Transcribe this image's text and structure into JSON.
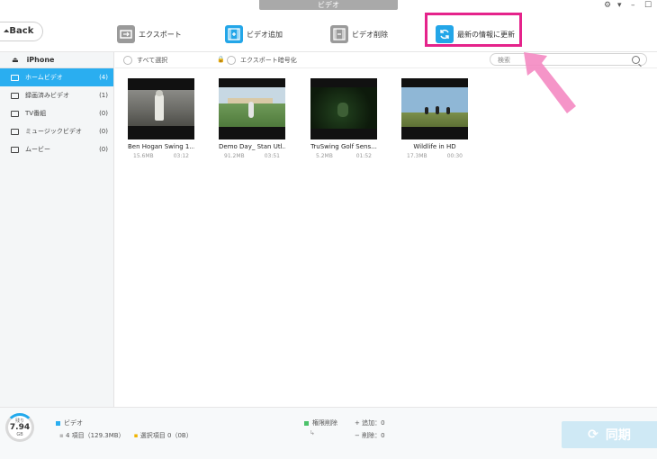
{
  "window": {
    "title": "ビデオ",
    "settings_icon": "gear-icon"
  },
  "toolbar": {
    "back_label": "Back",
    "export_label": "エクスポート",
    "add_label": "ビデオ追加",
    "delete_label": "ビデオ削除",
    "refresh_label": "最新の情報に更新"
  },
  "sidebar": {
    "device": "iPhone",
    "items": [
      {
        "label": "ホームビデオ",
        "count": "(4)",
        "icon": "home-video-icon",
        "active": true
      },
      {
        "label": "録画済みビデオ",
        "count": "(1)",
        "icon": "recorded-video-icon"
      },
      {
        "label": "TV番組",
        "count": "(0)",
        "icon": "tv-icon"
      },
      {
        "label": "ミュージックビデオ",
        "count": "(0)",
        "icon": "music-video-icon"
      },
      {
        "label": "ムービー",
        "count": "(0)",
        "icon": "movie-icon"
      }
    ]
  },
  "filter": {
    "select_all_label": "すべて選択",
    "encrypt_label": "エクスポート暗号化",
    "search_placeholder": "検索"
  },
  "videos": [
    {
      "name": "Ben Hogan Swing 1...",
      "size": "15.6MB",
      "duration": "03:12"
    },
    {
      "name": "Demo Day_ Stan Utl...",
      "size": "91.2MB",
      "duration": "03:51"
    },
    {
      "name": "TruSwing Golf Sens...",
      "size": "5.2MB",
      "duration": "01:52"
    },
    {
      "name": "Wildlife in HD",
      "size": "17.3MB",
      "duration": "00:30"
    }
  ],
  "footer": {
    "storage_label": "残り",
    "storage_value": "7.94",
    "storage_unit": "GB",
    "category_label": "ビデオ",
    "items_summary": "4 項目（129.3MB）",
    "selected_summary": "選択項目 0（0B）",
    "delete_section_label": "権限削除",
    "added_label": "追加：0",
    "removed_label": "削除：0",
    "sync_label": "同期"
  },
  "colors": {
    "accent": "#2aaef0",
    "highlight": "#e5238b",
    "arrow": "#f48ac2"
  }
}
